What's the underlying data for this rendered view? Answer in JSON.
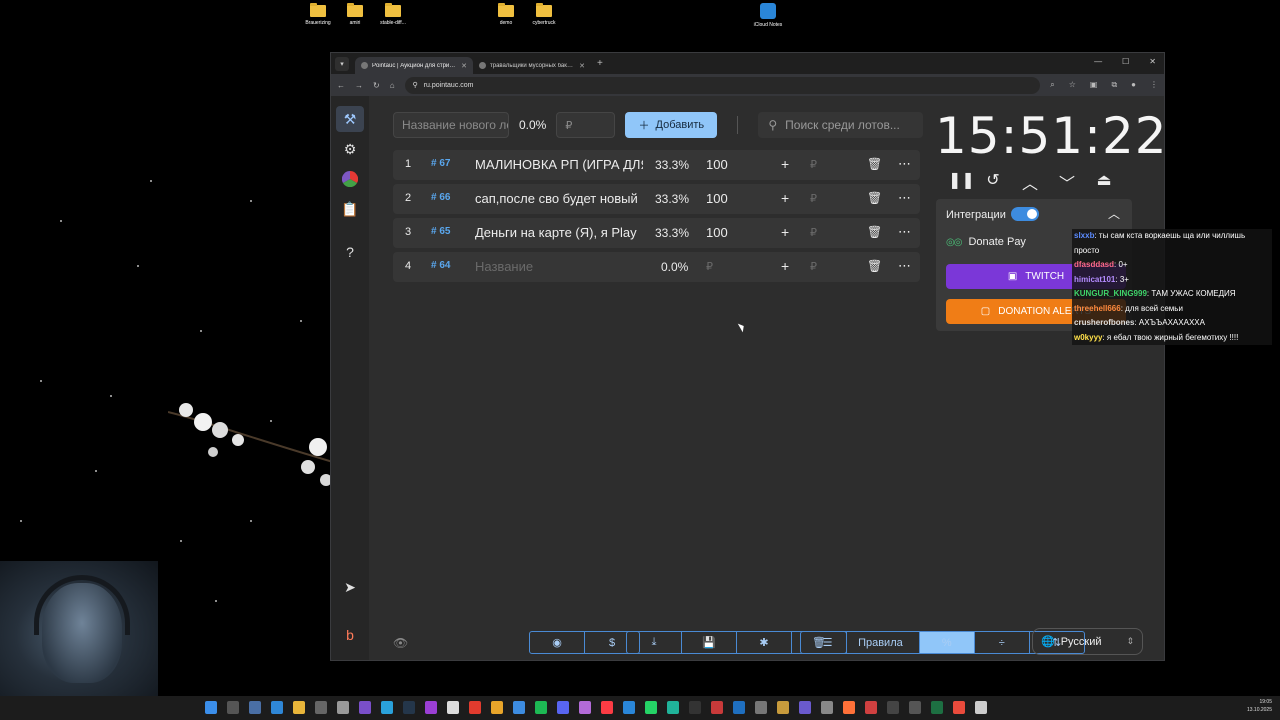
{
  "desktop": {
    "icons": [
      {
        "label": "Brauerizing"
      },
      {
        "label": "amiri"
      },
      {
        "label": "stable-diff..."
      },
      {
        "label": "demo"
      },
      {
        "label": "cybertruck"
      },
      {
        "label": "iCloud Notes"
      }
    ]
  },
  "browser": {
    "tabs": [
      {
        "title": "Pointauc | Аукцион для стрим..."
      },
      {
        "title": "травальщики мусорных баков..."
      }
    ],
    "url": "ru.pointauc.com"
  },
  "toolbar": {
    "name_placeholder": "Название нового лота",
    "total_percent": "0.0%",
    "amount_placeholder": "₽",
    "add_label": "Добавить",
    "search_placeholder": "Поиск среди лотов..."
  },
  "lots": [
    {
      "num": "1",
      "id": "67",
      "name": "МАЛИНОВКА РП (ИГРА ДЛЯ",
      "pct": "33.3%",
      "amount": "100",
      "rub": "₽"
    },
    {
      "num": "2",
      "id": "66",
      "name": "сап,после сво будет новый",
      "pct": "33.3%",
      "amount": "100",
      "rub": "₽"
    },
    {
      "num": "3",
      "id": "65",
      "name": "Деньги на карте (Я), я Play",
      "pct": "33.3%",
      "amount": "100",
      "rub": "₽"
    },
    {
      "num": "4",
      "id": "64",
      "name": "Название",
      "pct": "0.0%",
      "amount": "₽",
      "rub": "₽"
    }
  ],
  "timer": {
    "value": "15:51:22"
  },
  "integrations": {
    "title": "Интеграции",
    "donate_pay": "Donate Pay",
    "twitch": "TWITCH",
    "donation_alerts": "DONATION ALERTS"
  },
  "chat": [
    {
      "user": "slxxb",
      "text": "ты сам кста воркаешь ща или чиллишь просто",
      "color": "#5b8bff"
    },
    {
      "user": "dfasddasd",
      "text": "0+",
      "color": "#ff6a8a"
    },
    {
      "user": "himicat101",
      "text": "3+",
      "color": "#b48cff"
    },
    {
      "user": "KUNGUR_KING999",
      "text": "ТАМ УЖАС КОМЕДИЯ",
      "color": "#3fd46a"
    },
    {
      "user": "threehell666",
      "text": "для всей семьи",
      "color": "#ff8a3d"
    },
    {
      "user": "crusherofbones",
      "text": "АХЪЪАХАХАХХА",
      "color": "#dddddd"
    },
    {
      "user": "w0kyyy",
      "text": "я ебал твою жирный бегемотиху !!!!",
      "color": "#ffe14a"
    }
  ],
  "bottom": {
    "rules_label": "Правила",
    "language": "Русский"
  },
  "taskbar": {
    "time": "19:05",
    "date": "13.10.2025"
  },
  "colors": {
    "accent": "#90c6f9",
    "twitch": "#7b37d8",
    "donation_alerts": "#f07d16",
    "lot_id": "#5aa7ee"
  }
}
